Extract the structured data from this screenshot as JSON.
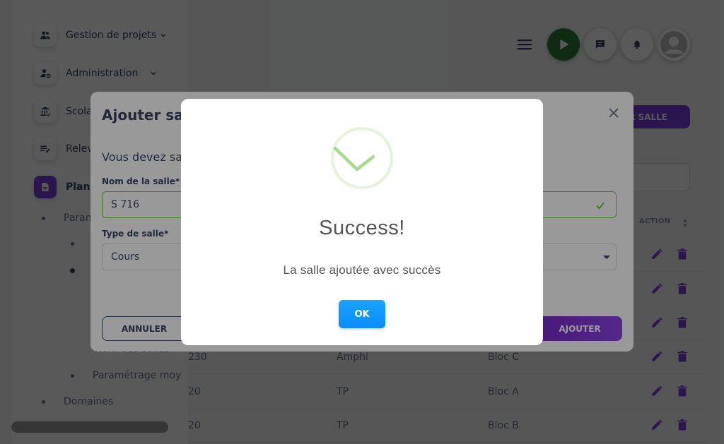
{
  "sidebar": {
    "items": [
      {
        "label": "Gestion de projets",
        "icon": "group-icon"
      },
      {
        "label": "Administration",
        "icon": "admin-user-icon"
      },
      {
        "label": "Scola",
        "icon": "institution-icon"
      },
      {
        "label": "Relev",
        "icon": "edit-list-icon"
      },
      {
        "label": "Plans",
        "icon": "document-icon"
      }
    ],
    "subitems": [
      {
        "label": "Param"
      },
      {
        "label": ""
      },
      {
        "label": ""
      },
      {
        "label": "Nom des salles"
      },
      {
        "label": "Paramétrage moy"
      },
      {
        "label": "Domaines"
      }
    ]
  },
  "header": {
    "add_button_label": "ER SALLE",
    "icons": [
      "menu-icon",
      "play-icon",
      "message-icon",
      "notification-icon",
      "avatar"
    ]
  },
  "table": {
    "action_header": "ACTION",
    "rows": [
      {
        "name": "",
        "type": "",
        "block": ""
      },
      {
        "name": "",
        "type": "",
        "block": ""
      },
      {
        "name": "",
        "type": "",
        "block": ""
      },
      {
        "name": "230",
        "type": "Amphi",
        "block": "Bloc C"
      },
      {
        "name": "20",
        "type": "TP",
        "block": "Bloc A"
      },
      {
        "name": "20",
        "type": "TP",
        "block": "Bloc B"
      }
    ]
  },
  "form_modal": {
    "title": "Ajouter sall",
    "notice": "Vous devez sa",
    "name_label": "Nom de la salle*",
    "name_value": "S 716",
    "type_label": "Type de salle*",
    "type_value": "Cours",
    "cancel_label": "ANNULER",
    "submit_label": "AJOUTER"
  },
  "success_dialog": {
    "title": "Success!",
    "message": "La salle ajoutée avec succès",
    "ok_label": "OK",
    "icon": "success-check-icon"
  },
  "colors": {
    "accent": "#7b3fe4",
    "success": "#a5dc86",
    "ok_button": "#1aa3ff",
    "valid_border": "#66d432"
  }
}
